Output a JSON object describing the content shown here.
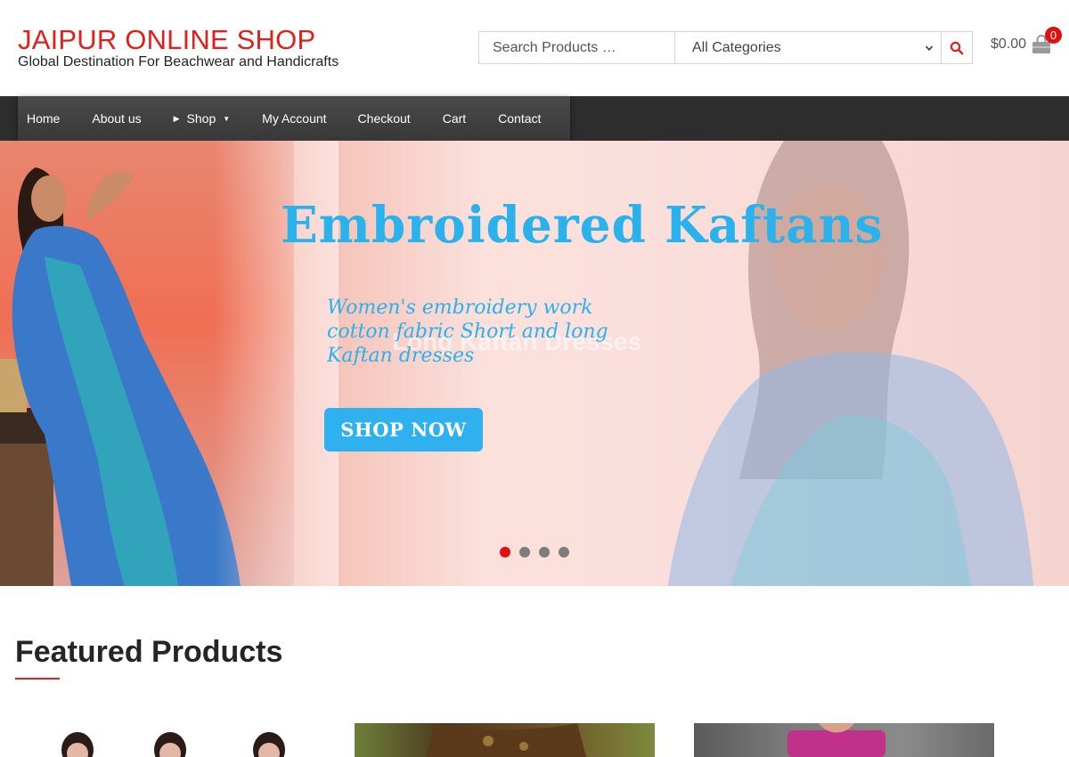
{
  "site": {
    "title": "JAIPUR ONLINE SHOP",
    "tagline": "Global Destination For Beachwear and Handicrafts"
  },
  "search": {
    "placeholder": "Search Products …",
    "category_selected": "All Categories",
    "button_icon": "search-icon"
  },
  "cart": {
    "total": "$0.00",
    "count": "0",
    "icon": "shopping-bag-icon"
  },
  "nav": {
    "items": [
      {
        "label": "Home"
      },
      {
        "label": "About us"
      },
      {
        "label": "Shop"
      },
      {
        "label": "My Account"
      },
      {
        "label": "Checkout"
      },
      {
        "label": "Cart"
      },
      {
        "label": "Contact"
      }
    ]
  },
  "hero": {
    "title": "Embroidered Kaftans",
    "subtitle": "Women's embroidery work cotton fabric Short and long Kaftan dresses",
    "ghost_text": "Long Kaftan Dresses",
    "button": "SHOP NOW",
    "slides": 4,
    "active_slide": 1
  },
  "featured": {
    "title": "Featured Products"
  },
  "colors": {
    "brand_red": "#e0201a",
    "nav_bg": "#2d2d2d",
    "hero_accent": "#2ab2ec"
  }
}
